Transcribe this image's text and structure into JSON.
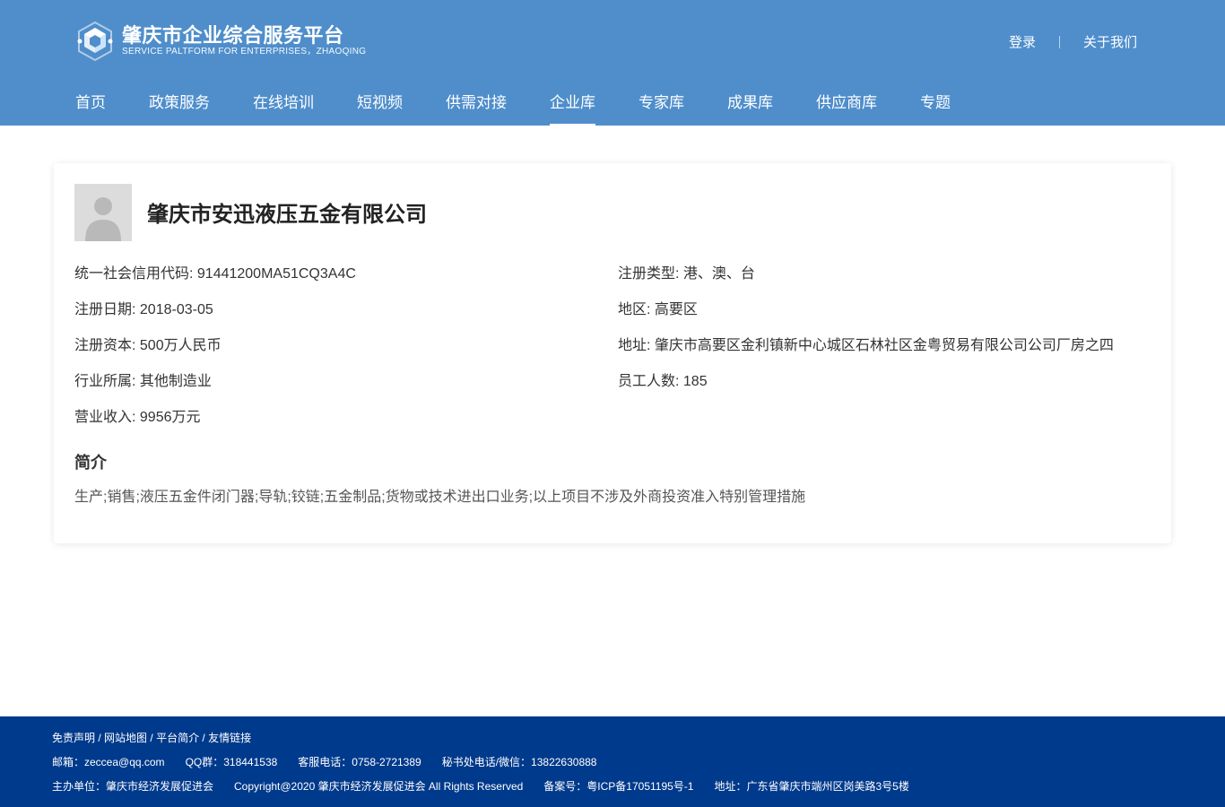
{
  "header": {
    "logo_cn": "肇庆市企业综合服务平台",
    "logo_en": "SERVICE PALTFORM FOR ENTERPRISES，ZHAOQING",
    "login": "登录",
    "about": "关于我们",
    "nav": [
      {
        "label": "首页"
      },
      {
        "label": "政策服务"
      },
      {
        "label": "在线培训"
      },
      {
        "label": "短视频"
      },
      {
        "label": "供需对接"
      },
      {
        "label": "企业库",
        "active": true
      },
      {
        "label": "专家库"
      },
      {
        "label": "成果库"
      },
      {
        "label": "供应商库"
      },
      {
        "label": "专题"
      }
    ]
  },
  "company": {
    "name": "肇庆市安迅液压五金有限公司",
    "credit_code": "统一社会信用代码: 91441200MA51CQ3A4C",
    "reg_type": "注册类型: 港、澳、台",
    "reg_date": "注册日期: 2018-03-05",
    "region": "地区: 高要区",
    "reg_capital": "注册资本: 500万人民币",
    "address": "地址: 肇庆市高要区金利镇新中心城区石林社区金粤贸易有限公司公司厂房之四",
    "industry": "行业所属: 其他制造业",
    "employees": "员工人数: 185",
    "revenue": "营业收入: 9956万元",
    "intro_title": "简介",
    "intro_text": "生产;销售;液压五金件闭门器;导轨;铰链;五金制品;货物或技术进出口业务;以上项目不涉及外商投资准入特别管理措施"
  },
  "footer": {
    "links": [
      "免责声明",
      "网站地图",
      "平台简介",
      "友情链接"
    ],
    "link_sep": " / ",
    "email": "邮箱：zeccea@qq.com",
    "qq": "QQ群：318441538",
    "phone": "客服电话：0758-2721389",
    "secretary": "秘书处电话/微信：13822630888",
    "sponsor": "主办单位：肇庆市经济发展促进会",
    "copyright": "Copyright@2020 肇庆市经济发展促进会 All Rights Reserved",
    "icp": "备案号：粤ICP备17051195号-1",
    "addr": "地址：广东省肇庆市端州区岗美路3号5楼"
  },
  "colors": {
    "header_bg": "#4f8ecb",
    "footer_bg": "#003a8c"
  }
}
